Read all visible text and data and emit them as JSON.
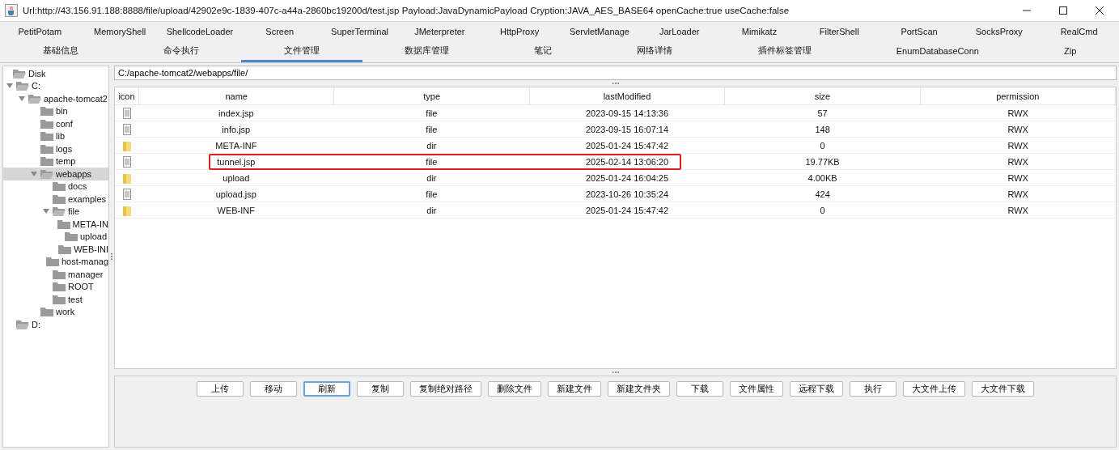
{
  "window": {
    "title": "Url:http://43.156.91.188:8888/file/upload/42902e9c-1839-407c-a44a-2860bc19200d/test.jsp Payload:JavaDynamicPayload Cryption:JAVA_AES_BASE64 openCache:true useCache:false"
  },
  "plugin_tabs": [
    {
      "label": "PetitPotam",
      "selected": false
    },
    {
      "label": "MemoryShell",
      "selected": false
    },
    {
      "label": "ShellcodeLoader",
      "selected": false
    },
    {
      "label": "Screen",
      "selected": false
    },
    {
      "label": "SuperTerminal",
      "selected": false
    },
    {
      "label": "JMeterpreter",
      "selected": false
    },
    {
      "label": "HttpProxy",
      "selected": false
    },
    {
      "label": "ServletManage",
      "selected": false
    },
    {
      "label": "JarLoader",
      "selected": false
    },
    {
      "label": "Mimikatz",
      "selected": false
    },
    {
      "label": "FilterShell",
      "selected": false
    },
    {
      "label": "PortScan",
      "selected": false
    },
    {
      "label": "SocksProxy",
      "selected": false
    },
    {
      "label": "RealCmd",
      "selected": false
    }
  ],
  "tabs": [
    {
      "label": "基础信息",
      "selected": false
    },
    {
      "label": "命令执行",
      "selected": false
    },
    {
      "label": "文件管理",
      "selected": true
    },
    {
      "label": "数据库管理",
      "selected": false
    },
    {
      "label": "笔记",
      "selected": false
    },
    {
      "label": "网络详情",
      "selected": false
    },
    {
      "label": "插件标签管理",
      "selected": false
    },
    {
      "label": "EnumDatabaseConn",
      "selected": false
    },
    {
      "label": "Zip",
      "selected": false
    }
  ],
  "tree": [
    {
      "label": "Disk",
      "kind": "root",
      "selected": false,
      "children": [
        {
          "label": "C:",
          "kind": "drive",
          "expanded": true,
          "selected": false,
          "children": [
            {
              "label": "apache-tomcat2",
              "kind": "folder",
              "expanded": true,
              "selected": false,
              "children": [
                {
                  "label": "bin",
                  "kind": "folder",
                  "selected": false
                },
                {
                  "label": "conf",
                  "kind": "folder",
                  "selected": false
                },
                {
                  "label": "lib",
                  "kind": "folder",
                  "selected": false
                },
                {
                  "label": "logs",
                  "kind": "folder",
                  "selected": false
                },
                {
                  "label": "temp",
                  "kind": "folder",
                  "selected": false
                },
                {
                  "label": "webapps",
                  "kind": "folder",
                  "expanded": true,
                  "selected": true,
                  "children": [
                    {
                      "label": "docs",
                      "kind": "folder",
                      "selected": false
                    },
                    {
                      "label": "examples",
                      "kind": "folder",
                      "selected": false
                    },
                    {
                      "label": "file",
                      "kind": "folder",
                      "expanded": true,
                      "selected": false,
                      "children": [
                        {
                          "label": "META-IN",
                          "kind": "folder",
                          "selected": false
                        },
                        {
                          "label": "upload",
                          "kind": "folder",
                          "selected": false
                        },
                        {
                          "label": "WEB-INI",
                          "kind": "folder",
                          "selected": false
                        }
                      ]
                    },
                    {
                      "label": "host-manag",
                      "kind": "folder",
                      "selected": false
                    },
                    {
                      "label": "manager",
                      "kind": "folder",
                      "selected": false
                    },
                    {
                      "label": "ROOT",
                      "kind": "folder",
                      "selected": false
                    },
                    {
                      "label": "test",
                      "kind": "folder",
                      "selected": false
                    }
                  ]
                },
                {
                  "label": "work",
                  "kind": "folder",
                  "selected": false
                }
              ]
            }
          ]
        },
        {
          "label": "D:",
          "kind": "drive",
          "expanded": false,
          "selected": false
        }
      ]
    }
  ],
  "path_field": {
    "value": "C:/apache-tomcat2/webapps/file/"
  },
  "table": {
    "columns": [
      "icon",
      "name",
      "type",
      "lastModified",
      "size",
      "permission"
    ],
    "rows": [
      {
        "kind": "file",
        "name": "index.jsp",
        "type": "file",
        "lastModified": "2023-09-15 14:13:36",
        "size": "57",
        "permission": "RWX",
        "highlighted": false
      },
      {
        "kind": "file",
        "name": "info.jsp",
        "type": "file",
        "lastModified": "2023-09-15 16:07:14",
        "size": "148",
        "permission": "RWX",
        "highlighted": false
      },
      {
        "kind": "dir",
        "name": "META-INF",
        "type": "dir",
        "lastModified": "2025-01-24 15:47:42",
        "size": "0",
        "permission": "RWX",
        "highlighted": false
      },
      {
        "kind": "file",
        "name": "tunnel.jsp",
        "type": "file",
        "lastModified": "2025-02-14 13:06:20",
        "size": "19.77KB",
        "permission": "RWX",
        "highlighted": true
      },
      {
        "kind": "dir",
        "name": "upload",
        "type": "dir",
        "lastModified": "2025-01-24 16:04:25",
        "size": "4.00KB",
        "permission": "RWX",
        "highlighted": false
      },
      {
        "kind": "file",
        "name": "upload.jsp",
        "type": "file",
        "lastModified": "2023-10-26 10:35:24",
        "size": "424",
        "permission": "RWX",
        "highlighted": false
      },
      {
        "kind": "dir",
        "name": "WEB-INF",
        "type": "dir",
        "lastModified": "2025-01-24 15:47:42",
        "size": "0",
        "permission": "RWX",
        "highlighted": false
      }
    ]
  },
  "buttons": [
    {
      "label": "上传",
      "focused": false
    },
    {
      "label": "移动",
      "focused": false
    },
    {
      "label": "刷新",
      "focused": true
    },
    {
      "label": "复制",
      "focused": false
    },
    {
      "label": "复制绝对路径",
      "focused": false
    },
    {
      "label": "删除文件",
      "focused": false
    },
    {
      "label": "新建文件",
      "focused": false
    },
    {
      "label": "新建文件夹",
      "focused": false
    },
    {
      "label": "下载",
      "focused": false
    },
    {
      "label": "文件属性",
      "focused": false
    },
    {
      "label": "远程下载",
      "focused": false
    },
    {
      "label": "执行",
      "focused": false
    },
    {
      "label": "大文件上传",
      "focused": false
    },
    {
      "label": "大文件下载",
      "focused": false
    }
  ]
}
